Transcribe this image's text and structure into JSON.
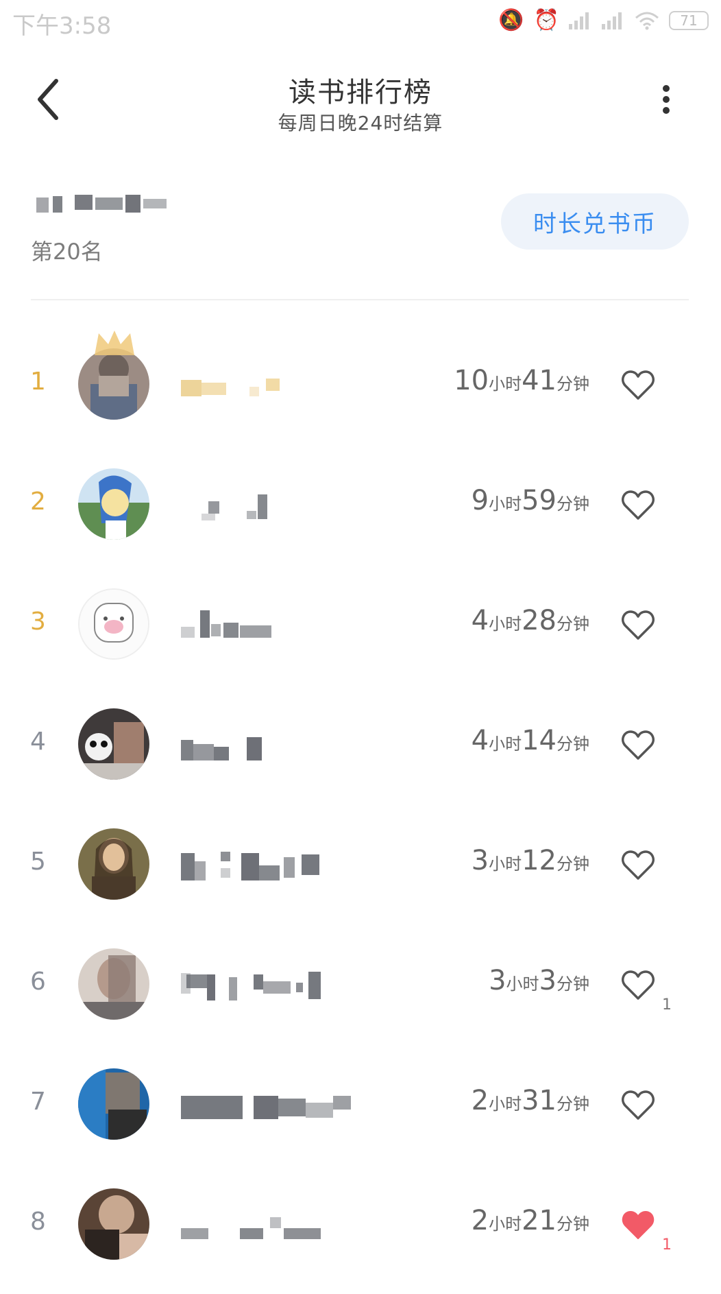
{
  "status_bar": {
    "time": "下午3:58",
    "battery": "71"
  },
  "header": {
    "title": "读书排行榜",
    "subtitle": "每周日晚24时结算"
  },
  "me": {
    "rank_label": "第20名",
    "coin_button_label": "时长兑书币"
  },
  "rankings": [
    {
      "rank": "1",
      "hours": "10",
      "hour_unit": "小时",
      "minutes": "41",
      "minute_unit": "分钟",
      "liked": false,
      "like_count": ""
    },
    {
      "rank": "2",
      "hours": "9",
      "hour_unit": "小时",
      "minutes": "59",
      "minute_unit": "分钟",
      "liked": false,
      "like_count": ""
    },
    {
      "rank": "3",
      "hours": "4",
      "hour_unit": "小时",
      "minutes": "28",
      "minute_unit": "分钟",
      "liked": false,
      "like_count": ""
    },
    {
      "rank": "4",
      "hours": "4",
      "hour_unit": "小时",
      "minutes": "14",
      "minute_unit": "分钟",
      "liked": false,
      "like_count": ""
    },
    {
      "rank": "5",
      "hours": "3",
      "hour_unit": "小时",
      "minutes": "12",
      "minute_unit": "分钟",
      "liked": false,
      "like_count": ""
    },
    {
      "rank": "6",
      "hours": "3",
      "hour_unit": "小时",
      "minutes": "3",
      "minute_unit": "分钟",
      "liked": false,
      "like_count": "1"
    },
    {
      "rank": "7",
      "hours": "2",
      "hour_unit": "小时",
      "minutes": "31",
      "minute_unit": "分钟",
      "liked": false,
      "like_count": ""
    },
    {
      "rank": "8",
      "hours": "2",
      "hour_unit": "小时",
      "minutes": "21",
      "minute_unit": "分钟",
      "liked": true,
      "like_count": "1"
    }
  ],
  "colors": {
    "accent_blue": "#3a8df0",
    "gold_rank": "#e2ad40",
    "like_red": "#f25a67"
  }
}
